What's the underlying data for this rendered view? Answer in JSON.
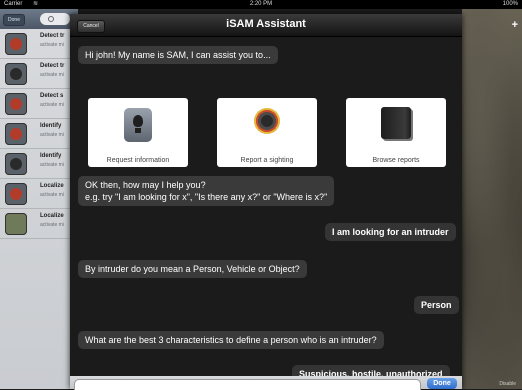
{
  "status_bar": {
    "carrier": "Carrier",
    "time": "2:20 PM",
    "battery": "100%"
  },
  "left_panel": {
    "done_label": "Done",
    "items": [
      {
        "title": "Detect tr",
        "subtitle": "activate mi"
      },
      {
        "title": "Detect tr",
        "subtitle": "activate mi"
      },
      {
        "title": "Detect s",
        "subtitle": "activate mi"
      },
      {
        "title": "Identify",
        "subtitle": "activate mi"
      },
      {
        "title": "Identify",
        "subtitle": "activate mi"
      },
      {
        "title": "Localize",
        "subtitle": "activate mi"
      },
      {
        "title": "Localize",
        "subtitle": "activate mi"
      }
    ]
  },
  "map": {
    "add_label": "+",
    "disable_label": "Disable"
  },
  "modal": {
    "cancel_label": "Cancel",
    "title": "iSAM Assistant",
    "greeting": "Hi john! My name is SAM, I can assist you to...",
    "choices": [
      {
        "label": "Request information",
        "icon": "lightbulb-icon"
      },
      {
        "label": "Report a sighting",
        "icon": "camera-lens-icon"
      },
      {
        "label": "Browse reports",
        "icon": "book-icon"
      }
    ],
    "messages": {
      "help_line1": "OK then, how may I help you?",
      "help_line2": "e.g. try \"I am looking for x\", \"Is there any x?\" or \"Where is x?\"",
      "user1": "I am looking for an intruder",
      "clarify": "By intruder do you mean a Person, Vehicle or Object?",
      "user2": "Person",
      "ask_traits": "What are the best 3 characteristics to define a person who is an intruder?",
      "user3": "Suspicious, hostile, unauthorized"
    },
    "send_label": "Done"
  }
}
